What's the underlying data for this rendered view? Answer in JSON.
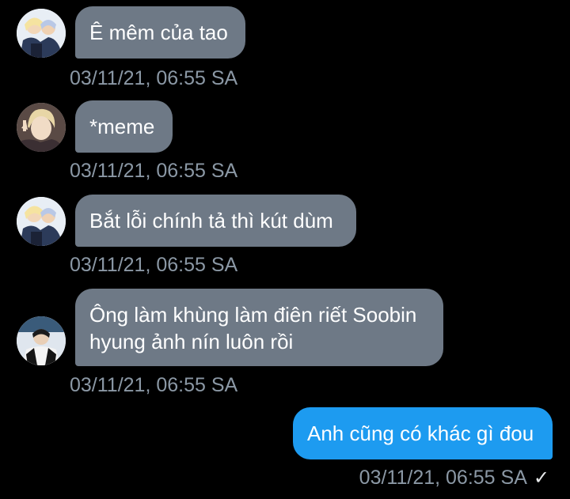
{
  "messages": [
    {
      "direction": "incoming",
      "avatar_icon": "avatar-icon",
      "text": "Ê mêm của tao",
      "time": "03/11/21, 06:55 SA"
    },
    {
      "direction": "incoming",
      "avatar_icon": "avatar-icon",
      "text": "*meme",
      "time": "03/11/21, 06:55 SA"
    },
    {
      "direction": "incoming",
      "avatar_icon": "avatar-icon",
      "text": "Bắt lỗi chính tả thì kút dùm",
      "time": "03/11/21, 06:55 SA"
    },
    {
      "direction": "incoming",
      "avatar_icon": "avatar-icon",
      "text_line1": "Ông làm khùng làm điên riết Soobin",
      "text_line2": "hyung ảnh nín luôn rồi",
      "time": "03/11/21, 06:55 SA"
    },
    {
      "direction": "outgoing",
      "text": "Anh cũng có khác gì đou",
      "time": "03/11/21, 06:55 SA",
      "status_icon": "checkmark-icon"
    }
  ],
  "colors": {
    "background": "#000000",
    "incoming_bubble": "#6e7986",
    "outgoing_bubble": "#1d9bf0",
    "timestamp": "#8b98a5"
  }
}
